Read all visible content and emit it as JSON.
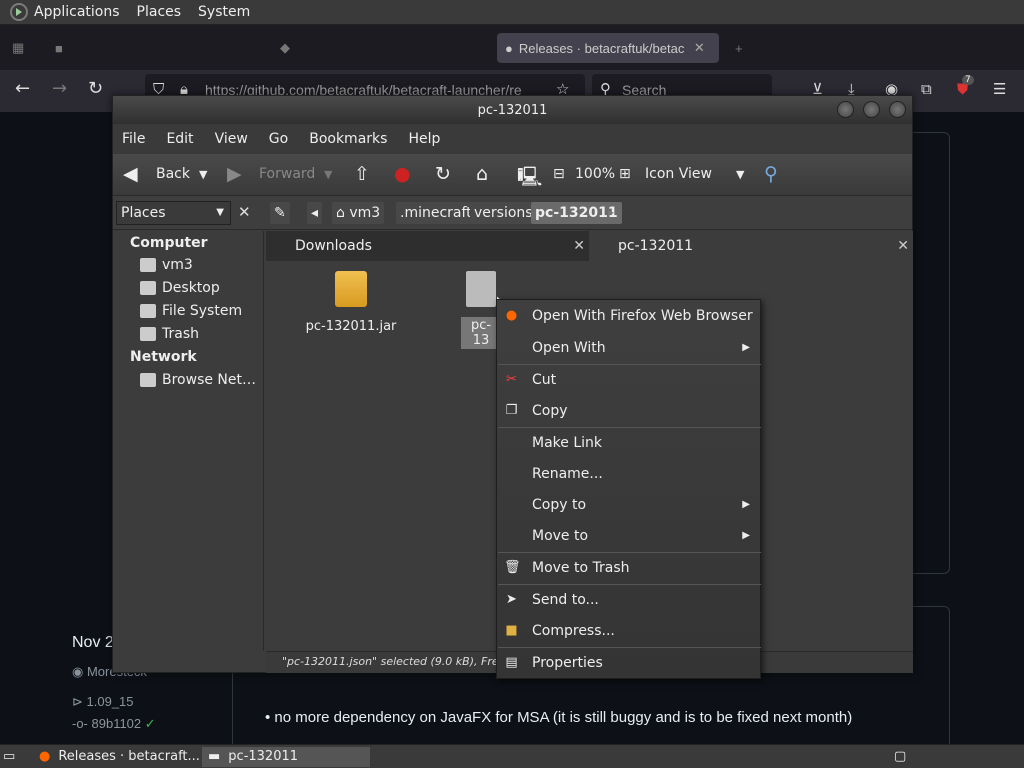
{
  "top_panel": {
    "menus": [
      "Applications",
      "Places",
      "System"
    ]
  },
  "firefox": {
    "tabs": [
      {
        "label": "Releases · betacraftuk/betac"
      }
    ],
    "url": "https://github.com/betacraftuk/betacraft-launcher/re",
    "search_placeholder": "Search",
    "extension_badge": "7"
  },
  "github": {
    "date": "Nov 2",
    "author": "Moresteck",
    "tag": "1.09_15",
    "commit": "89b1102",
    "bullet": "no more dependency on JavaFX for MSA (it is still buggy and is to be fixed next month)"
  },
  "nautilus": {
    "title": "pc-132011",
    "menu": [
      "File",
      "Edit",
      "View",
      "Go",
      "Bookmarks",
      "Help"
    ],
    "toolbar": {
      "back": "Back",
      "forward": "Forward",
      "zoom": "100%",
      "view_mode": "Icon View"
    },
    "places_label": "Places",
    "breadcrumbs": [
      "vm3",
      ".minecraft",
      "versions",
      "pc-132011"
    ],
    "sidebar": {
      "computer_heading": "Computer",
      "computer_items": [
        "vm3",
        "Desktop",
        "File System",
        "Trash"
      ],
      "network_heading": "Network",
      "network_items": [
        "Browse Net…"
      ]
    },
    "tabs": [
      "Downloads",
      "pc-132011"
    ],
    "files": [
      {
        "name": "pc-132011.jar"
      },
      {
        "name": "pc-13"
      }
    ],
    "status": "\"pc-132011.json\" selected (9.0 kB), Free spac"
  },
  "context_menu": [
    {
      "label": "Open With Firefox Web Browser",
      "icon": "firefox-icon"
    },
    {
      "label": "Open With",
      "submenu": true
    },
    {
      "label": "Cut",
      "icon": "scissors-icon"
    },
    {
      "label": "Copy",
      "icon": "copy-icon"
    },
    {
      "label": "Make Link"
    },
    {
      "label": "Rename..."
    },
    {
      "label": "Copy to",
      "submenu": true
    },
    {
      "label": "Move to",
      "submenu": true
    },
    {
      "label": "Move to Trash",
      "icon": "trash-icon"
    },
    {
      "label": "Send to...",
      "icon": "send-icon"
    },
    {
      "label": "Compress...",
      "icon": "archive-icon"
    },
    {
      "label": "Properties",
      "icon": "properties-icon"
    }
  ],
  "taskbar": {
    "items": [
      "Releases · betacraft...",
      "pc-132011"
    ]
  }
}
